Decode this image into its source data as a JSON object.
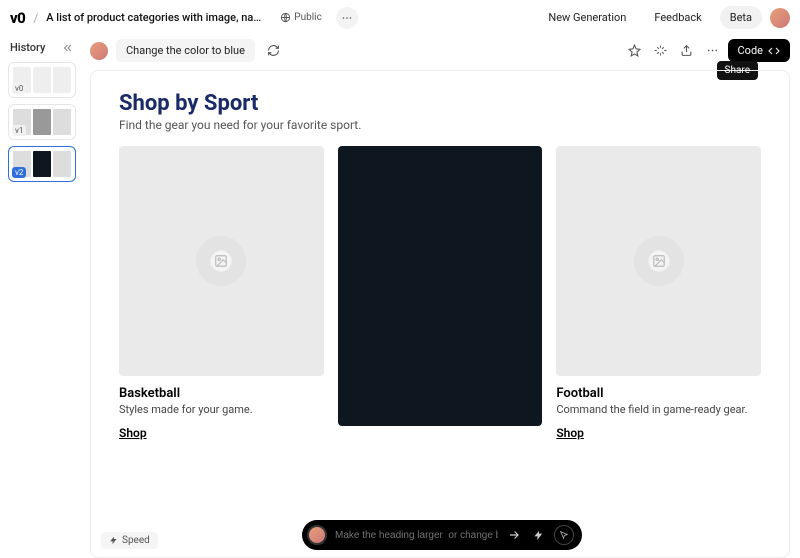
{
  "header": {
    "logo": "v0",
    "title": "A list of product categories with image, name and descri…",
    "visibility": "Public",
    "nav": {
      "new_gen": "New Generation",
      "feedback": "Feedback",
      "beta": "Beta"
    }
  },
  "sidebar": {
    "title": "History",
    "items": [
      {
        "label": "v0"
      },
      {
        "label": "v1"
      },
      {
        "label": "v2"
      }
    ]
  },
  "prompt": {
    "text": "Change the color to blue"
  },
  "actions": {
    "tooltip": "Share",
    "code": "Code"
  },
  "generation": {
    "title": "Shop by Sport",
    "subtitle": "Find the gear you need for your favorite sport.",
    "cards": [
      {
        "name": "Basketball",
        "desc": "Styles made for your game.",
        "link": "Shop"
      },
      {
        "name": "",
        "desc": "",
        "link": ""
      },
      {
        "name": "Football",
        "desc": "Command the field in game-ready gear.",
        "link": "Shop"
      }
    ]
  },
  "footer": {
    "speed": "Speed",
    "input_placeholder": "Make the heading larger  or change button color"
  }
}
